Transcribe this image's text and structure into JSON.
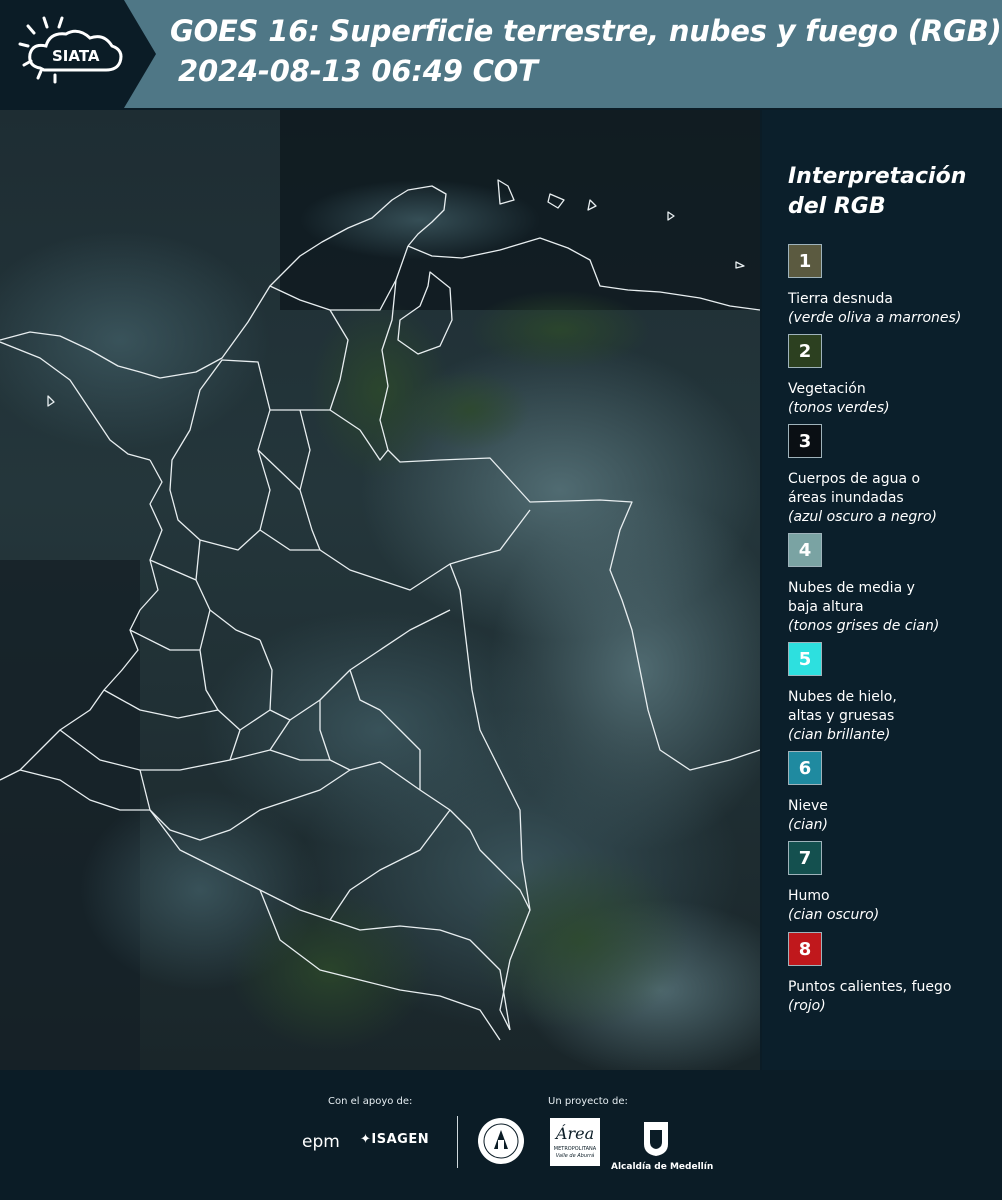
{
  "header": {
    "brand": "SIATA",
    "title": "GOES 16: Superficie terrestre, nubes y fuego (RGB)",
    "datetime": "2024-08-13 06:49 COT"
  },
  "legend": {
    "title_line1": "Interpretación",
    "title_line2": "del RGB",
    "items": [
      {
        "num": "1",
        "label": "Tierra desnuda",
        "sub": "(verde oliva a marrones)",
        "color": "#5b5a40"
      },
      {
        "num": "2",
        "label": "Vegetación",
        "sub": "(tonos verdes)",
        "color": "#2c4020"
      },
      {
        "num": "3",
        "label": "Cuerpos de agua o\náreas inundadas",
        "sub": "(azul oscuro a negro)",
        "color": "#0a0f14"
      },
      {
        "num": "4",
        "label": "Nubes de media y\nbaja altura",
        "sub": "(tonos grises de cian)",
        "color": "#7aa3a3"
      },
      {
        "num": "5",
        "label": "Nubes de hielo,\naltas y gruesas",
        "sub": "(cian brillante)",
        "color": "#2de0df"
      },
      {
        "num": "6",
        "label": "Nieve",
        "sub": "(cian)",
        "color": "#1f8aa0"
      },
      {
        "num": "7",
        "label": "Humo",
        "sub": "(cian oscuro)",
        "color": "#14504f"
      },
      {
        "num": "8",
        "label": "Puntos calientes, fuego",
        "sub": "(rojo)",
        "color": "#c0181c"
      }
    ]
  },
  "footer": {
    "support_label": "Con el apoyo de:",
    "project_label": "Un proyecto de:",
    "epm": "epm",
    "isagen": "ISAGEN",
    "area_name": "Área",
    "area_sub": "METROPOLITANA",
    "area_sub2": "Valle de Aburrá",
    "alcaldia": "Alcaldía de Medellín"
  }
}
